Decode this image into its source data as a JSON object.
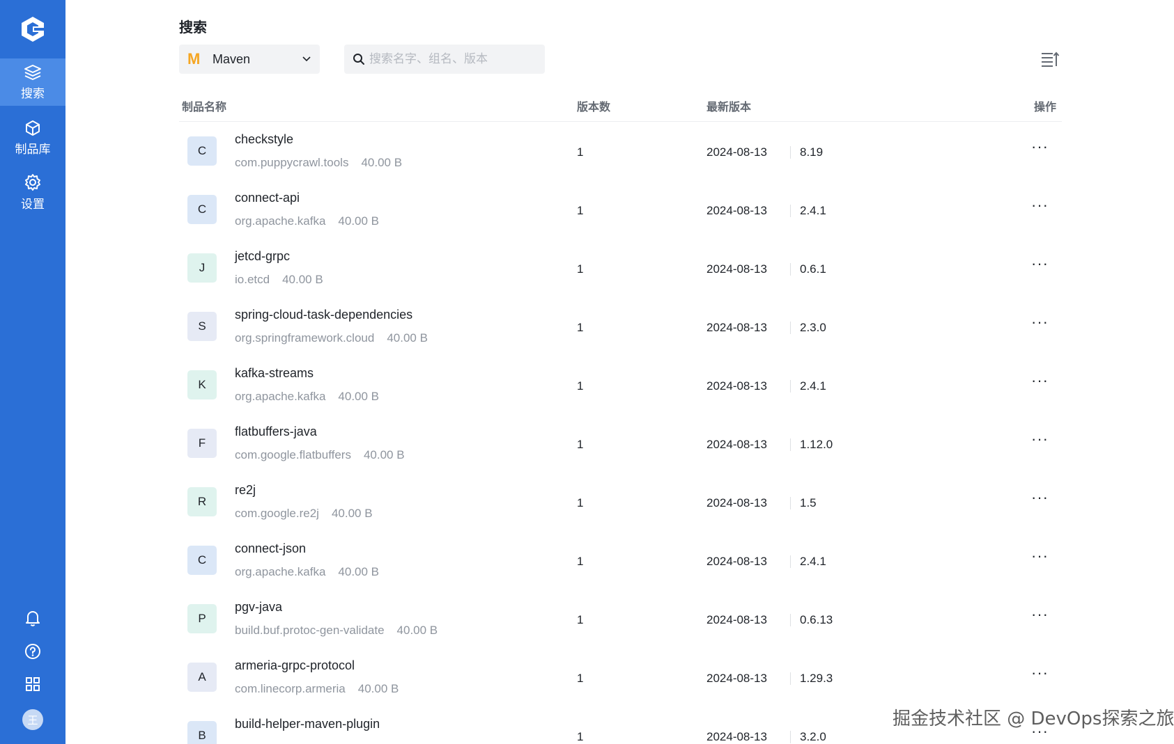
{
  "sidebar": {
    "nav": [
      {
        "label": "搜索",
        "icon": "layers-icon",
        "active": true
      },
      {
        "label": "制品库",
        "icon": "cube-icon",
        "active": false
      },
      {
        "label": "设置",
        "icon": "gear-icon",
        "active": false
      }
    ],
    "bottom_icons": [
      "bell-icon",
      "help-icon",
      "grid-icon"
    ],
    "avatar_text": "王"
  },
  "page": {
    "title": "搜索",
    "repo_type": {
      "letter": "M",
      "label": "Maven"
    },
    "search_placeholder": "搜索名字、组名、版本"
  },
  "table": {
    "headers": {
      "name": "制品名称",
      "count": "版本数",
      "latest": "最新版本",
      "actions": "操作"
    },
    "rows": [
      {
        "letter": "C",
        "name": "checkstyle",
        "group": "com.puppycrawl.tools",
        "size": "40.00 B",
        "count": "1",
        "date": "2024-08-13",
        "version": "8.19"
      },
      {
        "letter": "C",
        "name": "connect-api",
        "group": "org.apache.kafka",
        "size": "40.00 B",
        "count": "1",
        "date": "2024-08-13",
        "version": "2.4.1"
      },
      {
        "letter": "J",
        "name": "jetcd-grpc",
        "group": "io.etcd",
        "size": "40.00 B",
        "count": "1",
        "date": "2024-08-13",
        "version": "0.6.1"
      },
      {
        "letter": "S",
        "name": "spring-cloud-task-dependencies",
        "group": "org.springframework.cloud",
        "size": "40.00 B",
        "count": "1",
        "date": "2024-08-13",
        "version": "2.3.0"
      },
      {
        "letter": "K",
        "name": "kafka-streams",
        "group": "org.apache.kafka",
        "size": "40.00 B",
        "count": "1",
        "date": "2024-08-13",
        "version": "2.4.1"
      },
      {
        "letter": "F",
        "name": "flatbuffers-java",
        "group": "com.google.flatbuffers",
        "size": "40.00 B",
        "count": "1",
        "date": "2024-08-13",
        "version": "1.12.0"
      },
      {
        "letter": "R",
        "name": "re2j",
        "group": "com.google.re2j",
        "size": "40.00 B",
        "count": "1",
        "date": "2024-08-13",
        "version": "1.5"
      },
      {
        "letter": "C",
        "name": "connect-json",
        "group": "org.apache.kafka",
        "size": "40.00 B",
        "count": "1",
        "date": "2024-08-13",
        "version": "2.4.1"
      },
      {
        "letter": "P",
        "name": "pgv-java",
        "group": "build.buf.protoc-gen-validate",
        "size": "40.00 B",
        "count": "1",
        "date": "2024-08-13",
        "version": "0.6.13"
      },
      {
        "letter": "A",
        "name": "armeria-grpc-protocol",
        "group": "com.linecorp.armeria",
        "size": "40.00 B",
        "count": "1",
        "date": "2024-08-13",
        "version": "1.29.3"
      },
      {
        "letter": "B",
        "name": "build-helper-maven-plugin",
        "group": "",
        "size": "",
        "count": "1",
        "date": "2024-08-13",
        "version": "3.2.0"
      }
    ],
    "more_label": "···"
  },
  "watermark": "掘金技术社区 @ DevOps探索之旅",
  "colors": {
    "sidebar": "#2b6fd6",
    "sidebar_active": "#4b8be6",
    "maven": "#f5a623"
  }
}
